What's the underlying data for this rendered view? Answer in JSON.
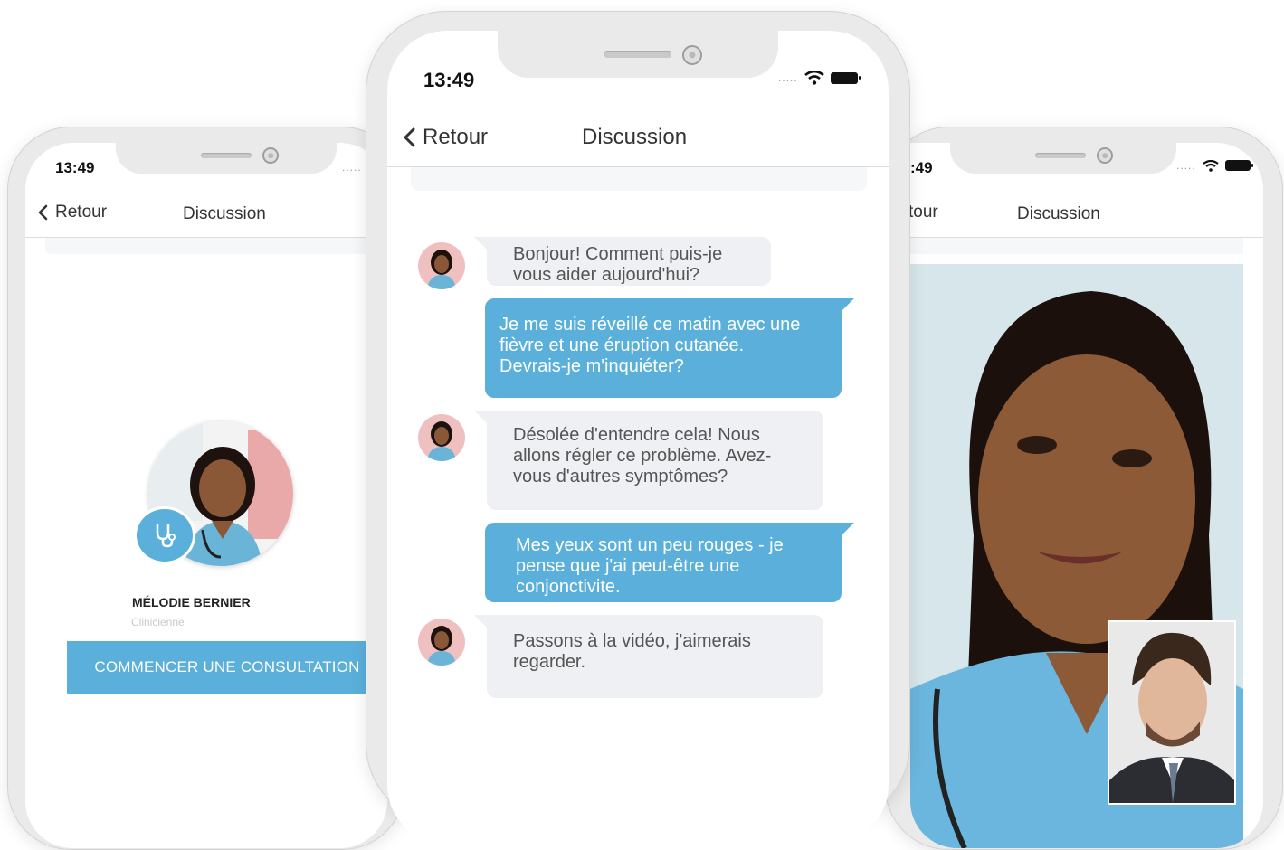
{
  "status": {
    "time": "13:49",
    "time_cropped": ":49",
    "signal_dots": "....."
  },
  "nav": {
    "back_label": "Retour",
    "back_label_cropped": "tour",
    "title": "Discussion"
  },
  "profile": {
    "name": "MÉLODIE BERNIER",
    "role": "Clinicienne",
    "cta_label": "COMMENCER UNE CONSULTATION"
  },
  "chat": {
    "messages": [
      {
        "from": "doctor",
        "text": "Bonjour! Comment puis-je vous aider aujourd'hui?"
      },
      {
        "from": "patient",
        "text": "Je me suis réveillé ce matin avec une fièvre et une éruption cutanée. Devrais-je m'inquiéter?"
      },
      {
        "from": "doctor",
        "text": "Désolée d'entendre cela! Nous allons régler ce problème. Avez-vous d'autres symptômes?"
      },
      {
        "from": "patient",
        "text": "Mes yeux sont un peu rouges - je pense que j'ai peut-être une conjonctivite."
      },
      {
        "from": "doctor",
        "text": "Passons à la vidéo, j'aimerais regarder."
      }
    ]
  },
  "colors": {
    "accent": "#5ab0da",
    "incoming_bubble": "#eef0f3",
    "frame": "#eaeaea"
  },
  "icons": [
    "chevron-left-icon",
    "wifi-icon",
    "battery-icon",
    "stethoscope-icon",
    "camera-icon",
    "speaker-icon"
  ]
}
